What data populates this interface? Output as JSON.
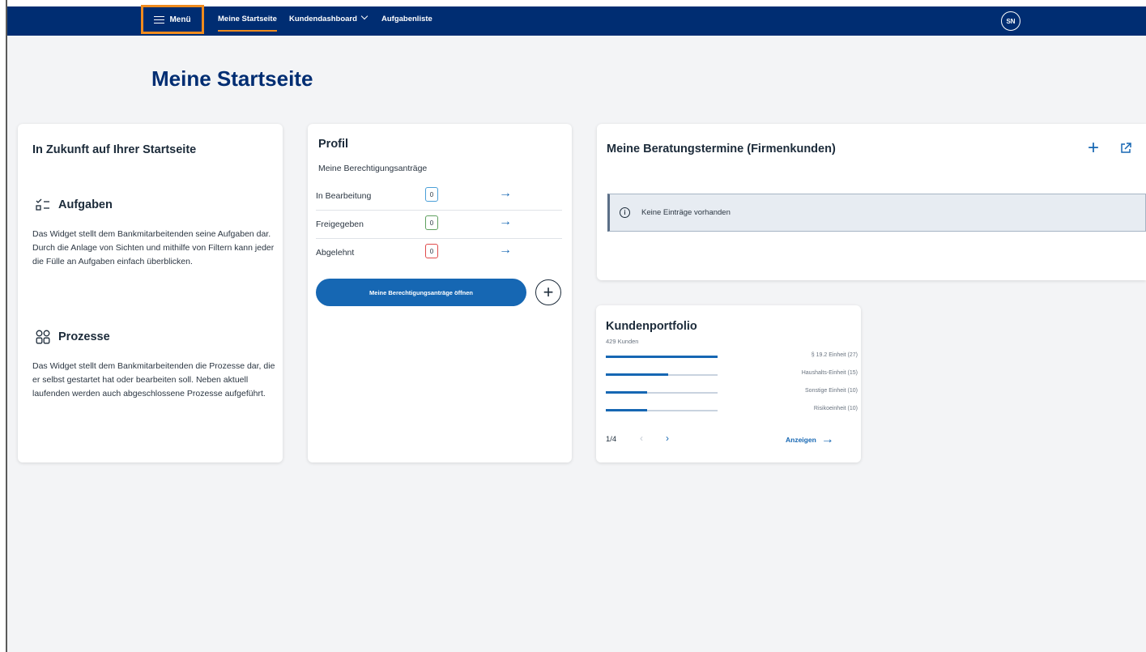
{
  "header": {
    "menu_label": "Menü",
    "nav": [
      {
        "label": "Meine Startseite",
        "active": true
      },
      {
        "label": "Kundendashboard",
        "has_dropdown": true
      },
      {
        "label": "Aufgabenliste"
      }
    ],
    "avatar_initials": "SN",
    "accent_color": "#ef8b1e",
    "bar_color": "#002d72"
  },
  "page_title": "Meine Startseite",
  "future_card": {
    "title": "In Zukunft auf Ihrer Startseite",
    "sections": [
      {
        "icon": "checklist-icon",
        "heading": "Aufgaben",
        "text": "Das Widget stellt dem Bankmitarbeitenden seine Aufgaben dar. Durch die Anlage von Sichten und mithilfe von Filtern kann jeder die Fülle an Aufgaben einfach überblicken."
      },
      {
        "icon": "process-icon",
        "heading": "Prozesse",
        "text": "Das Widget stellt dem Bankmitarbeitenden die Prozesse dar, die er selbst gestartet hat oder bearbeiten soll. Neben aktuell laufenden werden auch abgeschlossene Prozesse aufgeführt."
      }
    ]
  },
  "profile_card": {
    "title": "Profil",
    "subtitle": "Meine Berechtigungsanträge",
    "rows": [
      {
        "label": "In Bearbeitung",
        "count": "0",
        "color": "#4a9fd8"
      },
      {
        "label": "Freigegeben",
        "count": "0",
        "color": "#5fa05f"
      },
      {
        "label": "Abgelehnt",
        "count": "0",
        "color": "#e04b4b"
      }
    ],
    "open_button": "Meine Berechtigungsanträge öffnen"
  },
  "appointments_card": {
    "title": "Meine Beratungstermine (Firmenkunden)",
    "empty_message": "Keine Einträge vorhanden"
  },
  "portfolio_card": {
    "title": "Kundenportfolio",
    "subtitle": "429 Kunden",
    "items": [
      {
        "label": "§ 19.2 Einheit (27)",
        "fill": 1.0
      },
      {
        "label": "Haushalts-Einheit (15)",
        "fill": 0.56
      },
      {
        "label": "Sonstige Einheit (10)",
        "fill": 0.37
      },
      {
        "label": "Risikoeinheit (10)",
        "fill": 0.37
      }
    ],
    "pagination": "1/4",
    "show_label": "Anzeigen"
  }
}
